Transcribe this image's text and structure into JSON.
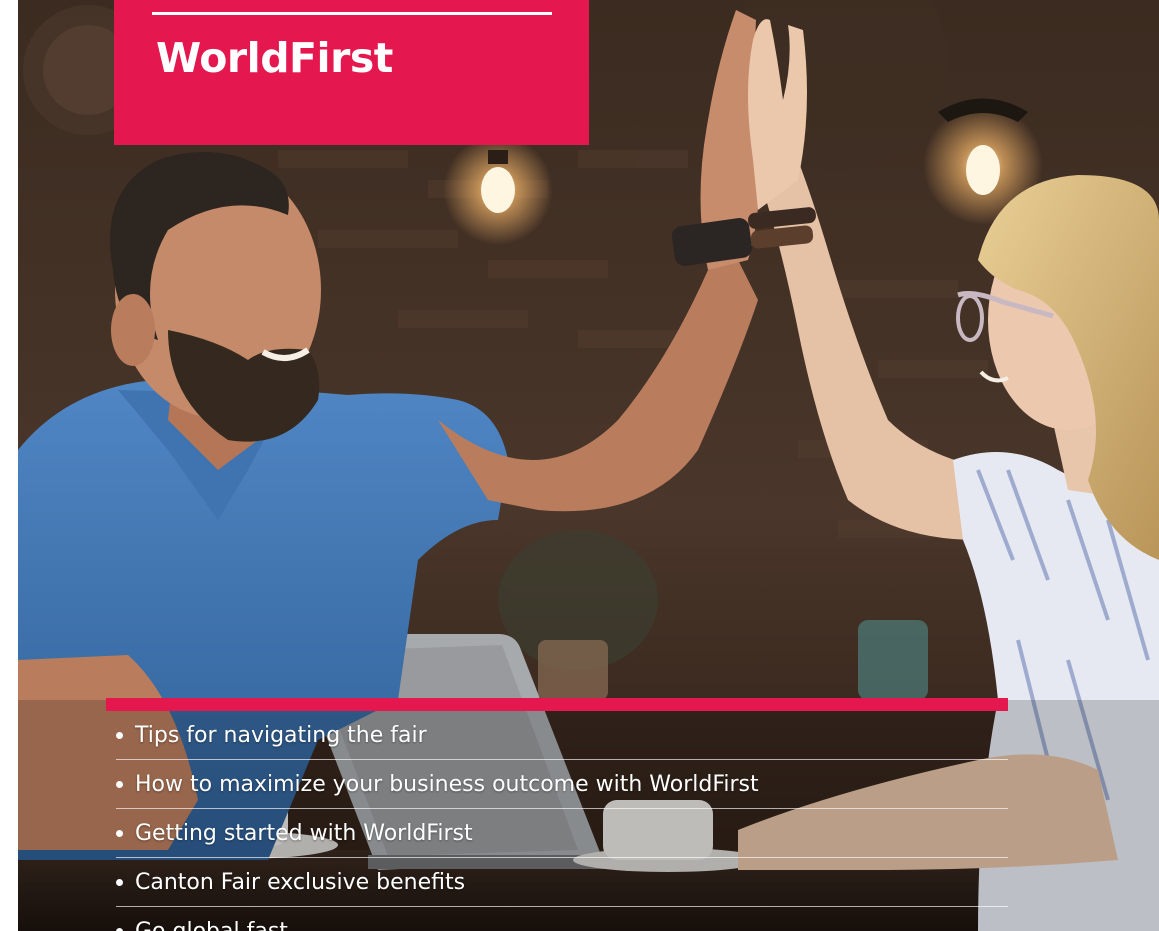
{
  "brand": {
    "name": "WorldFirst",
    "color": "#e5174f"
  },
  "photo": {
    "alt": "Two colleagues giving each other a high five in a café"
  },
  "bullets": [
    "Tips for navigating the fair",
    "How to maximize your business outcome with WorldFirst",
    "Getting started with WorldFirst",
    "Canton Fair exclusive benefits",
    "Go global fast"
  ]
}
